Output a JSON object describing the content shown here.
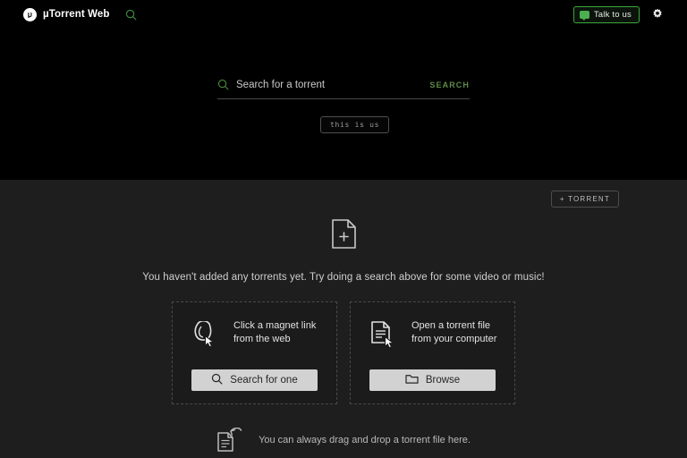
{
  "app": {
    "brand_name": "µTorrent Web",
    "logo_icon": "utorrent-logo-icon",
    "topbar_search_icon": "search-icon"
  },
  "topbar": {
    "talk_to_us_label": "Talk to us",
    "talk_to_us_icon": "chat-bubble-icon",
    "settings_icon": "gear-icon",
    "accent_green": "#39a83b"
  },
  "hero": {
    "search_placeholder": "Search for a torrent",
    "search_value": "",
    "search_icon": "search-icon",
    "search_button_label": "SEARCH",
    "search_button_color": "#5c8a48",
    "promo_button_label": "this is us"
  },
  "main": {
    "add_torrent_label": "+ TORRENT",
    "empty_icon": "file-plus-icon",
    "empty_message": "You haven't added any torrents yet. Try doing a search above for some video or music!",
    "cards": [
      {
        "icon": "magnet-cursor-icon",
        "line1": "Click a magnet link",
        "line2": "from the web",
        "button_label": "Search for one",
        "button_icon": "search-icon"
      },
      {
        "icon": "document-cursor-icon",
        "line1": "Open a torrent file",
        "line2": "from your computer",
        "button_label": "Browse",
        "button_icon": "folder-icon"
      }
    ],
    "drag_hint": {
      "icon": "document-drop-icon",
      "text": "You can always drag and drop a torrent file here."
    }
  }
}
